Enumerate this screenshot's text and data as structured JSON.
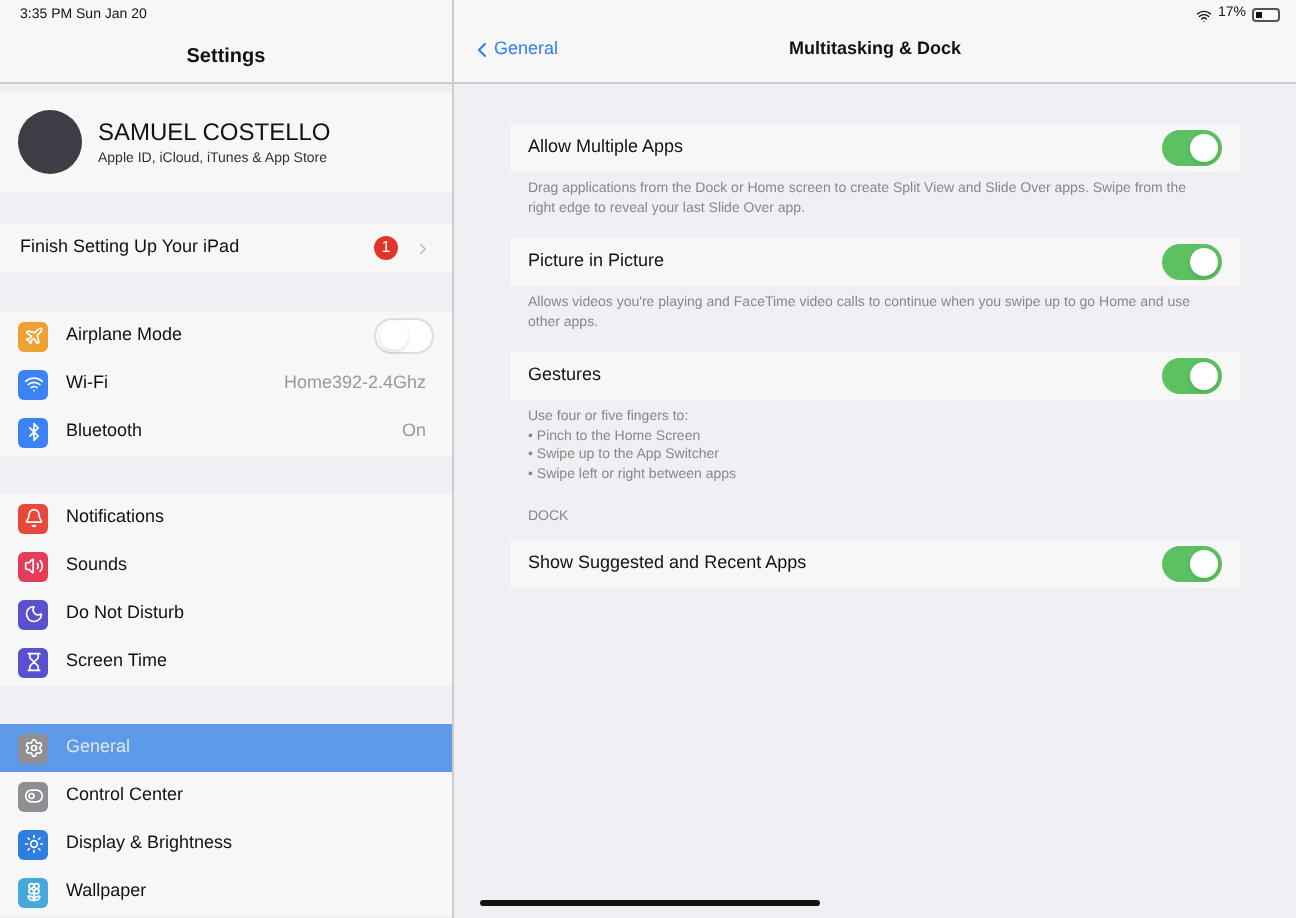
{
  "status_bar": {
    "time": "3:35 PM  Sun Jan 20",
    "battery": "17%"
  },
  "sidebar": {
    "title": "Settings",
    "profile": {
      "name": "SAMUEL COSTELLO",
      "subtitle": "Apple ID, iCloud, iTunes & App Store"
    },
    "setup": {
      "label": "Finish Setting Up Your iPad",
      "badge": "1"
    },
    "groups": [
      [
        {
          "label": "Airplane Mode",
          "kind": "toggle",
          "on": false,
          "color": "#f0a030",
          "selected": false
        },
        {
          "label": "Wi-Fi",
          "kind": "value",
          "value": "Home392-2.4Ghz",
          "color": "#3a82f6",
          "selected": false
        },
        {
          "label": "Bluetooth",
          "kind": "value",
          "value": "On",
          "color": "#3a82f6",
          "selected": false
        }
      ],
      [
        {
          "label": "Notifications",
          "kind": "link",
          "color": "#e8483c",
          "selected": false
        },
        {
          "label": "Sounds",
          "kind": "link",
          "color": "#e53c5a",
          "selected": false
        },
        {
          "label": "Do Not Disturb",
          "kind": "link",
          "color": "#5a4fcf",
          "selected": false
        },
        {
          "label": "Screen Time",
          "kind": "link",
          "color": "#5a4fcf",
          "selected": false
        }
      ],
      [
        {
          "label": "General",
          "kind": "link",
          "color": "#8e8e93",
          "selected": true
        },
        {
          "label": "Control Center",
          "kind": "link",
          "color": "#8e8e93",
          "selected": false
        },
        {
          "label": "Display & Brightness",
          "kind": "link",
          "color": "#2f7de1",
          "selected": false
        },
        {
          "label": "Wallpaper",
          "kind": "link",
          "color": "#45a9dc",
          "selected": false
        }
      ]
    ]
  },
  "detail": {
    "back": "General",
    "title": "Multitasking & Dock",
    "sections": [
      {
        "rows": [
          {
            "label": "Allow Multiple Apps",
            "on": true
          }
        ],
        "footer": [
          "Drag applications from the Dock or Home screen to create Split View and Slide Over apps. Swipe from the right edge to reveal your last Slide Over app."
        ]
      },
      {
        "rows": [
          {
            "label": "Picture in Picture",
            "on": true
          }
        ],
        "footer": [
          "Allows videos you're playing and FaceTime video calls to continue when you swipe up to go Home and use other apps."
        ]
      },
      {
        "rows": [
          {
            "label": "Gestures",
            "on": true
          }
        ],
        "footer": [
          "Use four or five fingers to:",
          "• Pinch to the Home Screen",
          "• Swipe up to the App Switcher",
          "• Swipe left or right between apps"
        ]
      },
      {
        "header": "DOCK",
        "rows": [
          {
            "label": "Show Suggested and Recent Apps",
            "on": true
          }
        ]
      }
    ]
  }
}
